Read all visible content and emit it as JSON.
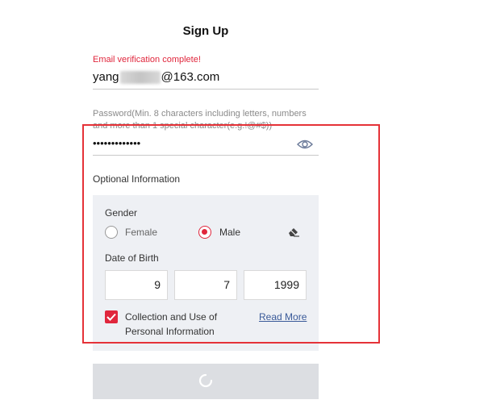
{
  "header": {
    "title": "Sign Up"
  },
  "email": {
    "status": "Email verification complete!",
    "value_prefix": "yang",
    "value_suffix": "@163.com"
  },
  "password": {
    "label": "Password(Min. 8 characters including letters, numbers and more than 1 special character(e.g.!@#$))",
    "value": "•••••••••••••",
    "toggle_icon": "eye-icon"
  },
  "optional": {
    "title": "Optional Information",
    "gender": {
      "label": "Gender",
      "options": [
        "Female",
        "Male"
      ],
      "selected": "Male",
      "clear_icon": "eraser-icon"
    },
    "dob": {
      "label": "Date of Birth",
      "day": "9",
      "month": "7",
      "year": "1999"
    },
    "consent": {
      "checked": true,
      "label": "Collection and Use of Personal Information",
      "read_more": "Read More"
    }
  },
  "submit": {
    "state": "loading",
    "icon": "spinner-icon"
  },
  "colors": {
    "accent": "#e0263c",
    "highlight_border": "#e53238",
    "section_bg": "#eef0f4",
    "button_bg": "#dcdee2",
    "link": "#3a5a99"
  }
}
